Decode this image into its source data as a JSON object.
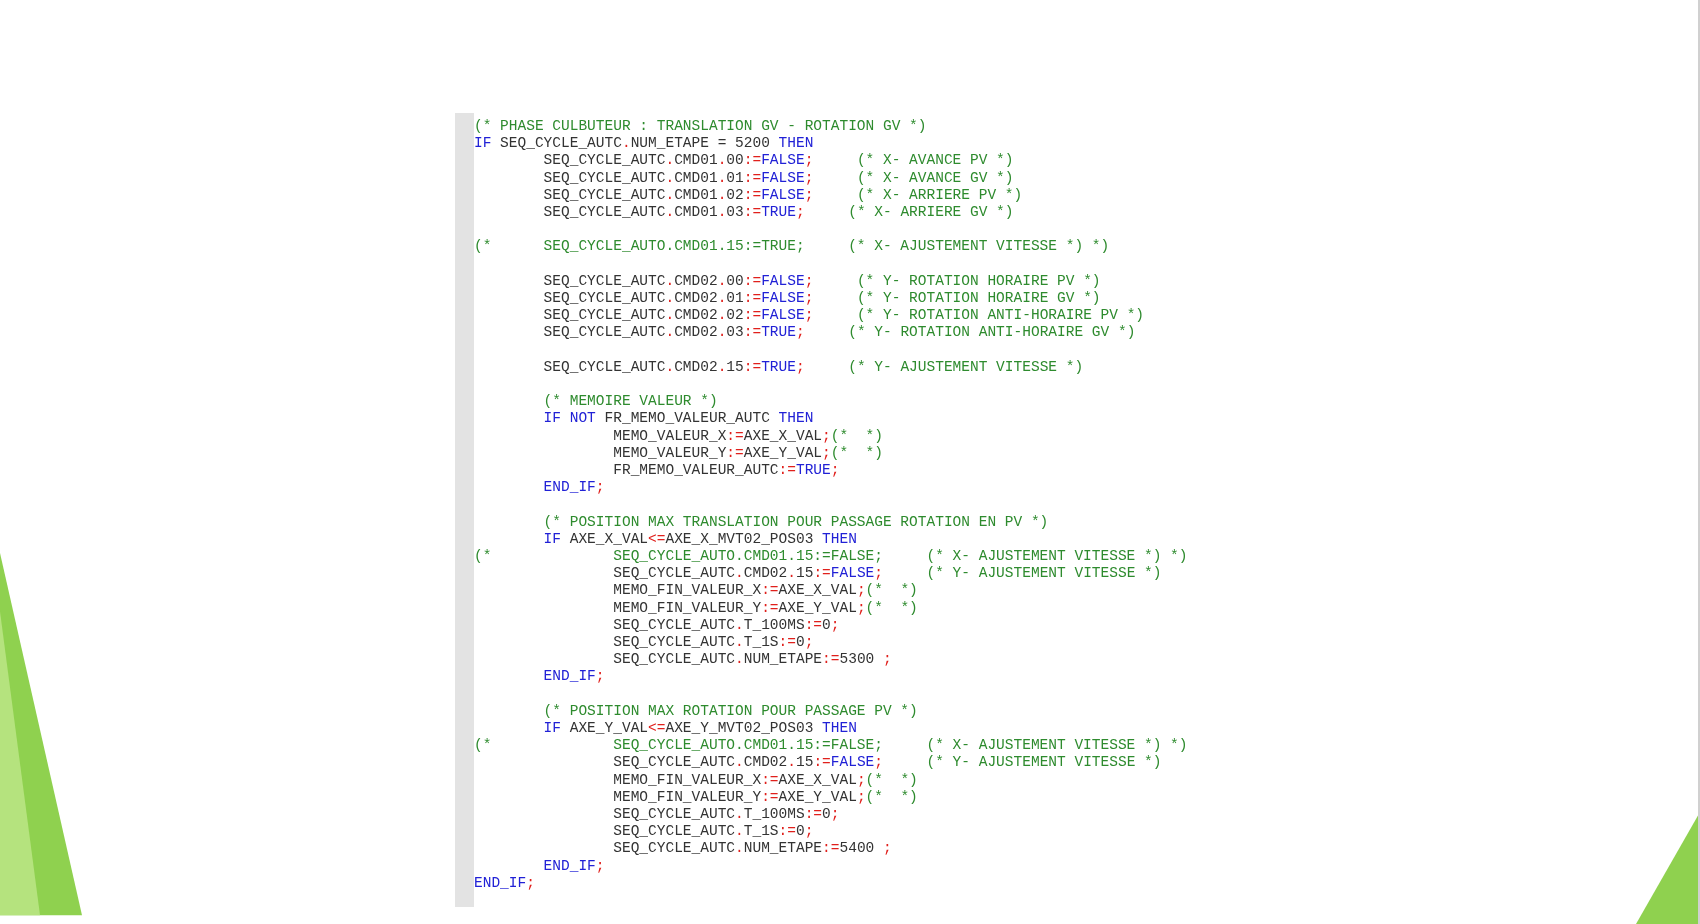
{
  "code_editor": {
    "paragraphs": [
      {
        "lines": [
          {
            "segments": [
              {
                "kind": "comment",
                "text": "(* PHASE CULBUTEUR : TRANSLATION GV - ROTATION GV *)"
              }
            ]
          },
          {
            "segments": [
              {
                "kind": "keyword",
                "text": "IF"
              },
              {
                "kind": "plain",
                "text": " SEQ_CYCLE_AUTC"
              },
              {
                "kind": "operator",
                "text": "."
              },
              {
                "kind": "plain",
                "text": "NUM_ETAPE = 5200 "
              },
              {
                "kind": "keyword",
                "text": "THEN"
              }
            ]
          },
          {
            "segments": [
              {
                "kind": "plain",
                "text": "        SEQ_CYCLE_AUTC"
              },
              {
                "kind": "operator",
                "text": "."
              },
              {
                "kind": "plain",
                "text": "CMD01"
              },
              {
                "kind": "operator",
                "text": "."
              },
              {
                "kind": "plain",
                "text": "00"
              },
              {
                "kind": "operator",
                "text": ":="
              },
              {
                "kind": "keyword",
                "text": "FALSE"
              },
              {
                "kind": "operator",
                "text": ";"
              },
              {
                "kind": "comment",
                "text": "     (* X- AVANCE PV *)"
              }
            ]
          },
          {
            "segments": [
              {
                "kind": "plain",
                "text": "        SEQ_CYCLE_AUTC"
              },
              {
                "kind": "operator",
                "text": "."
              },
              {
                "kind": "plain",
                "text": "CMD01"
              },
              {
                "kind": "operator",
                "text": "."
              },
              {
                "kind": "plain",
                "text": "01"
              },
              {
                "kind": "operator",
                "text": ":="
              },
              {
                "kind": "keyword",
                "text": "FALSE"
              },
              {
                "kind": "operator",
                "text": ";"
              },
              {
                "kind": "comment",
                "text": "     (* X- AVANCE GV *)"
              }
            ]
          },
          {
            "segments": [
              {
                "kind": "plain",
                "text": "        SEQ_CYCLE_AUTC"
              },
              {
                "kind": "operator",
                "text": "."
              },
              {
                "kind": "plain",
                "text": "CMD01"
              },
              {
                "kind": "operator",
                "text": "."
              },
              {
                "kind": "plain",
                "text": "02"
              },
              {
                "kind": "operator",
                "text": ":="
              },
              {
                "kind": "keyword",
                "text": "FALSE"
              },
              {
                "kind": "operator",
                "text": ";"
              },
              {
                "kind": "comment",
                "text": "     (* X- ARRIERE PV *)"
              }
            ]
          },
          {
            "segments": [
              {
                "kind": "plain",
                "text": "        SEQ_CYCLE_AUTC"
              },
              {
                "kind": "operator",
                "text": "."
              },
              {
                "kind": "plain",
                "text": "CMD01"
              },
              {
                "kind": "operator",
                "text": "."
              },
              {
                "kind": "plain",
                "text": "03"
              },
              {
                "kind": "operator",
                "text": ":="
              },
              {
                "kind": "keyword",
                "text": "TRUE"
              },
              {
                "kind": "operator",
                "text": ";"
              },
              {
                "kind": "comment",
                "text": "     (* X- ARRIERE GV *)"
              }
            ]
          }
        ]
      },
      {
        "lines": [
          {
            "segments": [
              {
                "kind": "comment",
                "text": "(*      SEQ_CYCLE_AUTO.CMD01.15:=TRUE;     (* X- AJUSTEMENT VITESSE *) *)"
              }
            ]
          }
        ]
      },
      {
        "lines": [
          {
            "segments": [
              {
                "kind": "plain",
                "text": "        SEQ_CYCLE_AUTC"
              },
              {
                "kind": "operator",
                "text": "."
              },
              {
                "kind": "plain",
                "text": "CMD02"
              },
              {
                "kind": "operator",
                "text": "."
              },
              {
                "kind": "plain",
                "text": "00"
              },
              {
                "kind": "operator",
                "text": ":="
              },
              {
                "kind": "keyword",
                "text": "FALSE"
              },
              {
                "kind": "operator",
                "text": ";"
              },
              {
                "kind": "comment",
                "text": "     (* Y- ROTATION HORAIRE PV *)"
              }
            ]
          },
          {
            "segments": [
              {
                "kind": "plain",
                "text": "        SEQ_CYCLE_AUTC"
              },
              {
                "kind": "operator",
                "text": "."
              },
              {
                "kind": "plain",
                "text": "CMD02"
              },
              {
                "kind": "operator",
                "text": "."
              },
              {
                "kind": "plain",
                "text": "01"
              },
              {
                "kind": "operator",
                "text": ":="
              },
              {
                "kind": "keyword",
                "text": "FALSE"
              },
              {
                "kind": "operator",
                "text": ";"
              },
              {
                "kind": "comment",
                "text": "     (* Y- ROTATION HORAIRE GV *)"
              }
            ]
          },
          {
            "segments": [
              {
                "kind": "plain",
                "text": "        SEQ_CYCLE_AUTC"
              },
              {
                "kind": "operator",
                "text": "."
              },
              {
                "kind": "plain",
                "text": "CMD02"
              },
              {
                "kind": "operator",
                "text": "."
              },
              {
                "kind": "plain",
                "text": "02"
              },
              {
                "kind": "operator",
                "text": ":="
              },
              {
                "kind": "keyword",
                "text": "FALSE"
              },
              {
                "kind": "operator",
                "text": ";"
              },
              {
                "kind": "comment",
                "text": "     (* Y- ROTATION ANTI-HORAIRE PV *)"
              }
            ]
          },
          {
            "segments": [
              {
                "kind": "plain",
                "text": "        SEQ_CYCLE_AUTC"
              },
              {
                "kind": "operator",
                "text": "."
              },
              {
                "kind": "plain",
                "text": "CMD02"
              },
              {
                "kind": "operator",
                "text": "."
              },
              {
                "kind": "plain",
                "text": "03"
              },
              {
                "kind": "operator",
                "text": ":="
              },
              {
                "kind": "keyword",
                "text": "TRUE"
              },
              {
                "kind": "operator",
                "text": ";"
              },
              {
                "kind": "comment",
                "text": "     (* Y- ROTATION ANTI-HORAIRE GV *)"
              }
            ]
          }
        ]
      },
      {
        "lines": [
          {
            "segments": [
              {
                "kind": "plain",
                "text": "        SEQ_CYCLE_AUTC"
              },
              {
                "kind": "operator",
                "text": "."
              },
              {
                "kind": "plain",
                "text": "CMD02"
              },
              {
                "kind": "operator",
                "text": "."
              },
              {
                "kind": "plain",
                "text": "15"
              },
              {
                "kind": "operator",
                "text": ":="
              },
              {
                "kind": "keyword",
                "text": "TRUE"
              },
              {
                "kind": "operator",
                "text": ";"
              },
              {
                "kind": "comment",
                "text": "     (* Y- AJUSTEMENT VITESSE *)"
              }
            ]
          }
        ]
      },
      {
        "lines": [
          {
            "segments": [
              {
                "kind": "comment",
                "text": "        (* MEMOIRE VALEUR *)"
              }
            ]
          },
          {
            "segments": [
              {
                "kind": "keyword",
                "text": "        IF NOT"
              },
              {
                "kind": "plain",
                "text": " FR_MEMO_VALEUR_AUTC "
              },
              {
                "kind": "keyword",
                "text": "THEN"
              }
            ]
          },
          {
            "segments": [
              {
                "kind": "plain",
                "text": "                MEMO_VALEUR_X"
              },
              {
                "kind": "operator",
                "text": ":="
              },
              {
                "kind": "plain",
                "text": "AXE_X_VAL"
              },
              {
                "kind": "operator",
                "text": ";"
              },
              {
                "kind": "comment",
                "text": "(*  *)"
              }
            ]
          },
          {
            "segments": [
              {
                "kind": "plain",
                "text": "                MEMO_VALEUR_Y"
              },
              {
                "kind": "operator",
                "text": ":="
              },
              {
                "kind": "plain",
                "text": "AXE_Y_VAL"
              },
              {
                "kind": "operator",
                "text": ";"
              },
              {
                "kind": "comment",
                "text": "(*  *)"
              }
            ]
          },
          {
            "segments": [
              {
                "kind": "plain",
                "text": "                FR_MEMO_VALEUR_AUTC"
              },
              {
                "kind": "operator",
                "text": ":="
              },
              {
                "kind": "keyword",
                "text": "TRUE"
              },
              {
                "kind": "operator",
                "text": ";"
              }
            ]
          },
          {
            "segments": [
              {
                "kind": "keyword",
                "text": "        END_IF"
              },
              {
                "kind": "operator",
                "text": ";"
              }
            ]
          }
        ]
      },
      {
        "lines": [
          {
            "segments": [
              {
                "kind": "comment",
                "text": "        (* POSITION MAX TRANSLATION POUR PASSAGE ROTATION EN PV *)"
              }
            ]
          },
          {
            "segments": [
              {
                "kind": "keyword",
                "text": "        IF"
              },
              {
                "kind": "plain",
                "text": " AXE_X_VAL"
              },
              {
                "kind": "operator",
                "text": "<="
              },
              {
                "kind": "plain",
                "text": "AXE_X_MVT02_POS03 "
              },
              {
                "kind": "keyword",
                "text": "THEN"
              }
            ]
          },
          {
            "segments": [
              {
                "kind": "comment",
                "text": "(*              SEQ_CYCLE_AUTO.CMD01.15:=FALSE;     (* X- AJUSTEMENT VITESSE *) *)"
              }
            ]
          },
          {
            "segments": [
              {
                "kind": "plain",
                "text": "                SEQ_CYCLE_AUTC"
              },
              {
                "kind": "operator",
                "text": "."
              },
              {
                "kind": "plain",
                "text": "CMD02"
              },
              {
                "kind": "operator",
                "text": "."
              },
              {
                "kind": "plain",
                "text": "15"
              },
              {
                "kind": "operator",
                "text": ":="
              },
              {
                "kind": "keyword",
                "text": "FALSE"
              },
              {
                "kind": "operator",
                "text": ";"
              },
              {
                "kind": "comment",
                "text": "     (* Y- AJUSTEMENT VITESSE *)"
              }
            ]
          },
          {
            "segments": [
              {
                "kind": "plain",
                "text": "                MEMO_FIN_VALEUR_X"
              },
              {
                "kind": "operator",
                "text": ":="
              },
              {
                "kind": "plain",
                "text": "AXE_X_VAL"
              },
              {
                "kind": "operator",
                "text": ";"
              },
              {
                "kind": "comment",
                "text": "(*  *)"
              }
            ]
          },
          {
            "segments": [
              {
                "kind": "plain",
                "text": "                MEMO_FIN_VALEUR_Y"
              },
              {
                "kind": "operator",
                "text": ":="
              },
              {
                "kind": "plain",
                "text": "AXE_Y_VAL"
              },
              {
                "kind": "operator",
                "text": ";"
              },
              {
                "kind": "comment",
                "text": "(*  *)"
              }
            ]
          },
          {
            "segments": [
              {
                "kind": "plain",
                "text": "                SEQ_CYCLE_AUTC"
              },
              {
                "kind": "operator",
                "text": "."
              },
              {
                "kind": "plain",
                "text": "T_100MS"
              },
              {
                "kind": "operator",
                "text": ":="
              },
              {
                "kind": "plain",
                "text": "0"
              },
              {
                "kind": "operator",
                "text": ";"
              }
            ]
          },
          {
            "segments": [
              {
                "kind": "plain",
                "text": "                SEQ_CYCLE_AUTC"
              },
              {
                "kind": "operator",
                "text": "."
              },
              {
                "kind": "plain",
                "text": "T_1S"
              },
              {
                "kind": "operator",
                "text": ":="
              },
              {
                "kind": "plain",
                "text": "0"
              },
              {
                "kind": "operator",
                "text": ";"
              }
            ]
          },
          {
            "segments": [
              {
                "kind": "plain",
                "text": "                SEQ_CYCLE_AUTC"
              },
              {
                "kind": "operator",
                "text": "."
              },
              {
                "kind": "plain",
                "text": "NUM_ETAPE"
              },
              {
                "kind": "operator",
                "text": ":="
              },
              {
                "kind": "plain",
                "text": "5300 "
              },
              {
                "kind": "operator",
                "text": ";"
              }
            ]
          },
          {
            "segments": [
              {
                "kind": "keyword",
                "text": "        END_IF"
              },
              {
                "kind": "operator",
                "text": ";"
              }
            ]
          }
        ]
      },
      {
        "lines": [
          {
            "segments": [
              {
                "kind": "comment",
                "text": "        (* POSITION MAX ROTATION POUR PASSAGE PV *)"
              }
            ]
          },
          {
            "segments": [
              {
                "kind": "keyword",
                "text": "        IF"
              },
              {
                "kind": "plain",
                "text": " AXE_Y_VAL"
              },
              {
                "kind": "operator",
                "text": "<="
              },
              {
                "kind": "plain",
                "text": "AXE_Y_MVT02_POS03 "
              },
              {
                "kind": "keyword",
                "text": "THEN"
              }
            ]
          },
          {
            "segments": [
              {
                "kind": "comment",
                "text": "(*              SEQ_CYCLE_AUTO.CMD01.15:=FALSE;     (* X- AJUSTEMENT VITESSE *) *)"
              }
            ]
          },
          {
            "segments": [
              {
                "kind": "plain",
                "text": "                SEQ_CYCLE_AUTC"
              },
              {
                "kind": "operator",
                "text": "."
              },
              {
                "kind": "plain",
                "text": "CMD02"
              },
              {
                "kind": "operator",
                "text": "."
              },
              {
                "kind": "plain",
                "text": "15"
              },
              {
                "kind": "operator",
                "text": ":="
              },
              {
                "kind": "keyword",
                "text": "FALSE"
              },
              {
                "kind": "operator",
                "text": ";"
              },
              {
                "kind": "comment",
                "text": "     (* Y- AJUSTEMENT VITESSE *)"
              }
            ]
          },
          {
            "segments": [
              {
                "kind": "plain",
                "text": "                MEMO_FIN_VALEUR_X"
              },
              {
                "kind": "operator",
                "text": ":="
              },
              {
                "kind": "plain",
                "text": "AXE_X_VAL"
              },
              {
                "kind": "operator",
                "text": ";"
              },
              {
                "kind": "comment",
                "text": "(*  *)"
              }
            ]
          },
          {
            "segments": [
              {
                "kind": "plain",
                "text": "                MEMO_FIN_VALEUR_Y"
              },
              {
                "kind": "operator",
                "text": ":="
              },
              {
                "kind": "plain",
                "text": "AXE_Y_VAL"
              },
              {
                "kind": "operator",
                "text": ";"
              },
              {
                "kind": "comment",
                "text": "(*  *)"
              }
            ]
          },
          {
            "segments": [
              {
                "kind": "plain",
                "text": "                SEQ_CYCLE_AUTC"
              },
              {
                "kind": "operator",
                "text": "."
              },
              {
                "kind": "plain",
                "text": "T_100MS"
              },
              {
                "kind": "operator",
                "text": ":="
              },
              {
                "kind": "plain",
                "text": "0"
              },
              {
                "kind": "operator",
                "text": ";"
              }
            ]
          },
          {
            "segments": [
              {
                "kind": "plain",
                "text": "                SEQ_CYCLE_AUTC"
              },
              {
                "kind": "operator",
                "text": "."
              },
              {
                "kind": "plain",
                "text": "T_1S"
              },
              {
                "kind": "operator",
                "text": ":="
              },
              {
                "kind": "plain",
                "text": "0"
              },
              {
                "kind": "operator",
                "text": ";"
              }
            ]
          },
          {
            "segments": [
              {
                "kind": "plain",
                "text": "                SEQ_CYCLE_AUTC"
              },
              {
                "kind": "operator",
                "text": "."
              },
              {
                "kind": "plain",
                "text": "NUM_ETAPE"
              },
              {
                "kind": "operator",
                "text": ":="
              },
              {
                "kind": "plain",
                "text": "5400 "
              },
              {
                "kind": "operator",
                "text": ";"
              }
            ]
          },
          {
            "segments": [
              {
                "kind": "keyword",
                "text": "        END_IF"
              },
              {
                "kind": "operator",
                "text": ";"
              }
            ]
          },
          {
            "segments": [
              {
                "kind": "keyword",
                "text": "END_IF"
              },
              {
                "kind": "operator",
                "text": ";"
              }
            ]
          }
        ]
      }
    ]
  }
}
